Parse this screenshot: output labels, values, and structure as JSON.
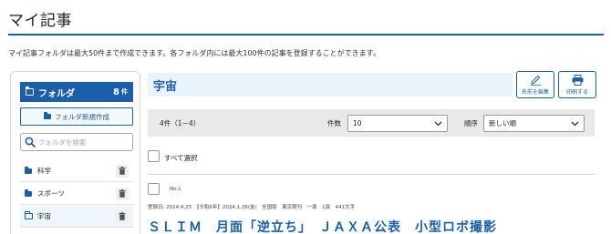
{
  "page": {
    "title": "マイ記事",
    "description": "マイ記事フォルダは最大50件まで作成できます。各フォルダ内には最大100件の記事を登録することができます。"
  },
  "sidebar": {
    "header_label": "フォルダ",
    "folder_count": "8",
    "count_unit": "件",
    "new_folder_label": "フォルダ新規作成",
    "search_placeholder": "フォルダを検索",
    "items": [
      {
        "label": "科学",
        "icon": "folder-icon",
        "active": false
      },
      {
        "label": "スポーツ",
        "icon": "folder-icon",
        "active": false
      },
      {
        "label": "宇宙",
        "icon": "folder-open-icon",
        "active": true
      }
    ]
  },
  "main": {
    "folder_title": "宇宙",
    "rename_label": "名前を編集",
    "print_label": "印刷する",
    "result_count": "4件（1－4）",
    "per_page_label": "件数",
    "per_page_value": "10",
    "sort_label": "順序",
    "sort_value": "新しい順",
    "select_all_label": "すべて選択"
  },
  "article": {
    "number": "No.1",
    "meta": "登録日: 2024.4.25　【令和6年】2024.1.26(金)　全国版　東京朝刊　一面　1頁　441文字",
    "headline": "ＳＬＩＭ　月面「逆立ち」　ＪＡＸＡ公表　小型ロボ撮影"
  },
  "colors": {
    "accent": "#1b5fa8",
    "title_bar_bg": "#e8f3fb",
    "filter_bar_bg": "#e9e9e9"
  }
}
